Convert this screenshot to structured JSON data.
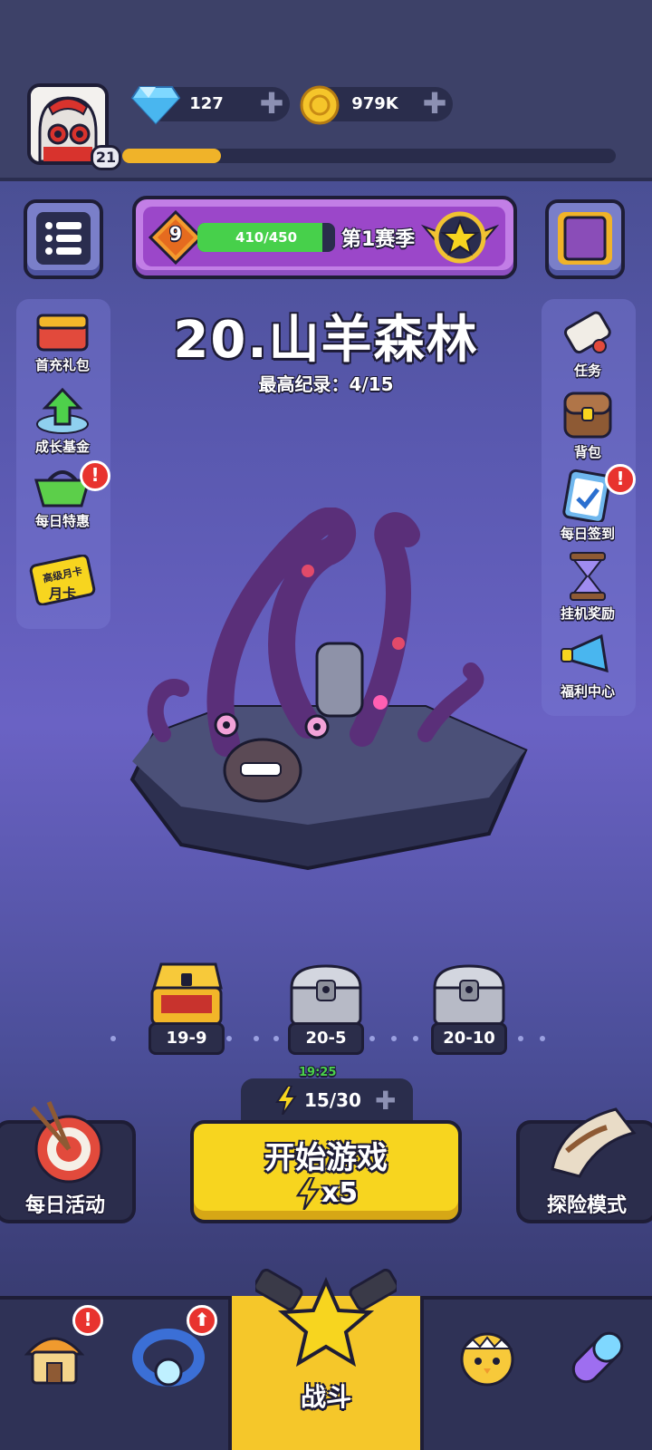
{
  "player": {
    "level": "21",
    "xp_progress": 0.2
  },
  "currency": {
    "diamonds": "127",
    "coins": "979K",
    "plus": "✚"
  },
  "season": {
    "rank": "9",
    "progress_text": "410/450",
    "progress": 0.911,
    "label": "第1赛季"
  },
  "stage": {
    "title": "20.山羊森林",
    "record": "最高纪录：4/15"
  },
  "left_menu": [
    {
      "label": "首充礼包",
      "badge": ""
    },
    {
      "label": "成长基金",
      "badge": ""
    },
    {
      "label": "每日特惠",
      "badge": "!"
    },
    {
      "label": "月卡",
      "sub": "高级月卡",
      "badge": ""
    }
  ],
  "right_menu": [
    {
      "label": "任务",
      "badge": ""
    },
    {
      "label": "背包",
      "badge": ""
    },
    {
      "label": "每日签到",
      "badge": "!"
    },
    {
      "label": "挂机奖励",
      "badge": ""
    },
    {
      "label": "福利中心",
      "badge": ""
    }
  ],
  "chests": [
    {
      "label": "19-9",
      "state": "opened"
    },
    {
      "label": "20-5",
      "state": "locked"
    },
    {
      "label": "20-10",
      "state": "locked"
    }
  ],
  "energy": {
    "timer": "19:25",
    "value": "15/30",
    "plus": "✚"
  },
  "start_button": {
    "label": "开始游戏",
    "cost": "x5"
  },
  "daily_activity": {
    "label": "每日活动"
  },
  "adventure_mode": {
    "label": "探险模式"
  },
  "bottom_nav": {
    "shop_badge": "!",
    "equip_badge": "⬆",
    "battle_label": "战斗"
  },
  "colors": {
    "accent_yellow": "#f7d51f",
    "season_purple": "#9b47c9",
    "xp_gold": "#f0b329",
    "progress_green": "#47d04b",
    "badge_red": "#e8332e"
  }
}
